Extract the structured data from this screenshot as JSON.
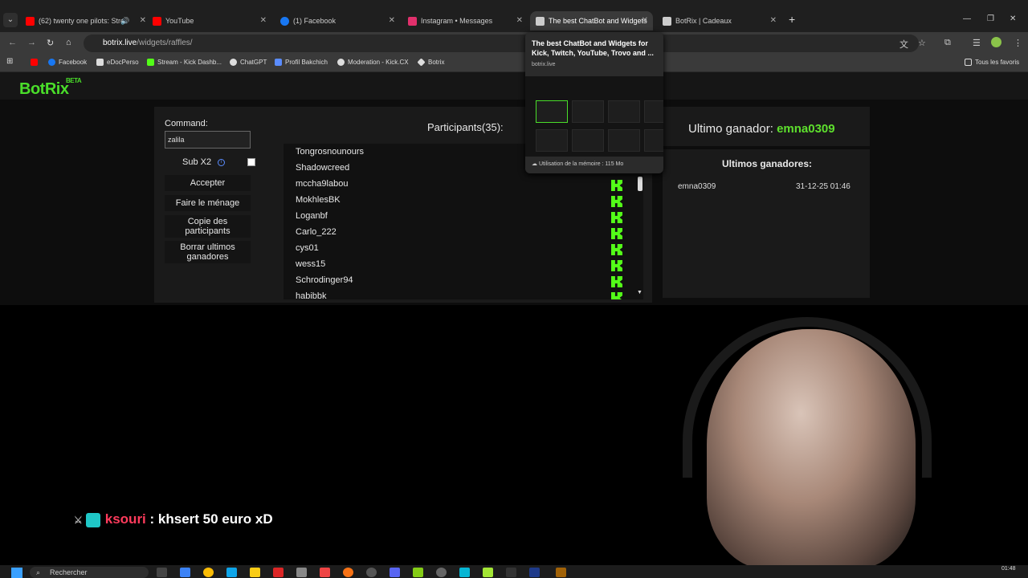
{
  "browser": {
    "tabs": [
      {
        "label": "(62) twenty one pilots: Stre",
        "icon": "youtube-icon",
        "color": "#ff0000"
      },
      {
        "label": "YouTube",
        "icon": "youtube-icon",
        "color": "#ff0000"
      },
      {
        "label": "(1) Facebook",
        "icon": "facebook-icon",
        "color": "#1877f2"
      },
      {
        "label": "Instagram • Messages",
        "icon": "instagram-icon",
        "color": "#e1306c"
      },
      {
        "label": "The best ChatBot and Widgets",
        "icon": "botrix-icon",
        "color": "#cccccc"
      },
      {
        "label": "BotRix | Cadeaux",
        "icon": "botrix-icon",
        "color": "#cccccc"
      }
    ],
    "url_host": "botrix.live",
    "url_path": "/widgets/raffles/",
    "bookmarks": [
      {
        "label": "",
        "icon": "youtube-icon",
        "color": "#ff0000"
      },
      {
        "label": "Facebook",
        "icon": "facebook-icon",
        "color": "#1877f2"
      },
      {
        "label": "eDocPerso",
        "icon": "doc-icon",
        "color": "#dddddd"
      },
      {
        "label": "Stream - Kick Dashb...",
        "icon": "kick-icon",
        "color": "#53fc18"
      },
      {
        "label": "ChatGPT",
        "icon": "chatgpt-icon",
        "color": "#dddddd"
      },
      {
        "label": "Profil Bakchich",
        "icon": "profile-icon",
        "color": "#5a8cff"
      },
      {
        "label": "Moderation - Kick.CX",
        "icon": "gear-icon",
        "color": "#dddddd"
      },
      {
        "label": "Botrix",
        "icon": "botrix-icon",
        "color": "#dddddd"
      }
    ],
    "all_favorites": "Tous les favoris"
  },
  "tooltip": {
    "title": "The best ChatBot and Widgets for Kick, Twitch, YouTube, Trovo and ...",
    "domain": "botrix.live",
    "memory": "Utilisation de la mémoire : 115 Mo"
  },
  "app": {
    "logo": "BotRix",
    "beta": "BETA",
    "command_label": "Command:",
    "command_value": "zalila",
    "sub_label": "Sub X2",
    "buttons": {
      "accept": "Accepter",
      "clean": "Faire le ménage",
      "copy": "Copie des participants",
      "clear_winners": "Borrar ultimos ganadores"
    },
    "participants_title": "Participants(35):",
    "participants": [
      "Tongrosnounours",
      "Shadowcreed",
      "mccha9labou",
      "MokhlesBK",
      "Loganbf",
      "Carlo_222",
      "cys01",
      "wess15",
      "Schrodinger94",
      "habibbk"
    ],
    "last_winner_label": "Ultimo ganador:",
    "last_winner": "emna0309",
    "last_winners_title": "Ultimos ganadores:",
    "winners": [
      {
        "name": "emna0309",
        "date": "31-12-25 01:46"
      }
    ]
  },
  "stream": {
    "chat_user": "ksouri",
    "chat_message": ": khsert 50 euro xD"
  },
  "taskbar": {
    "search": "Rechercher",
    "time": "01:48"
  }
}
